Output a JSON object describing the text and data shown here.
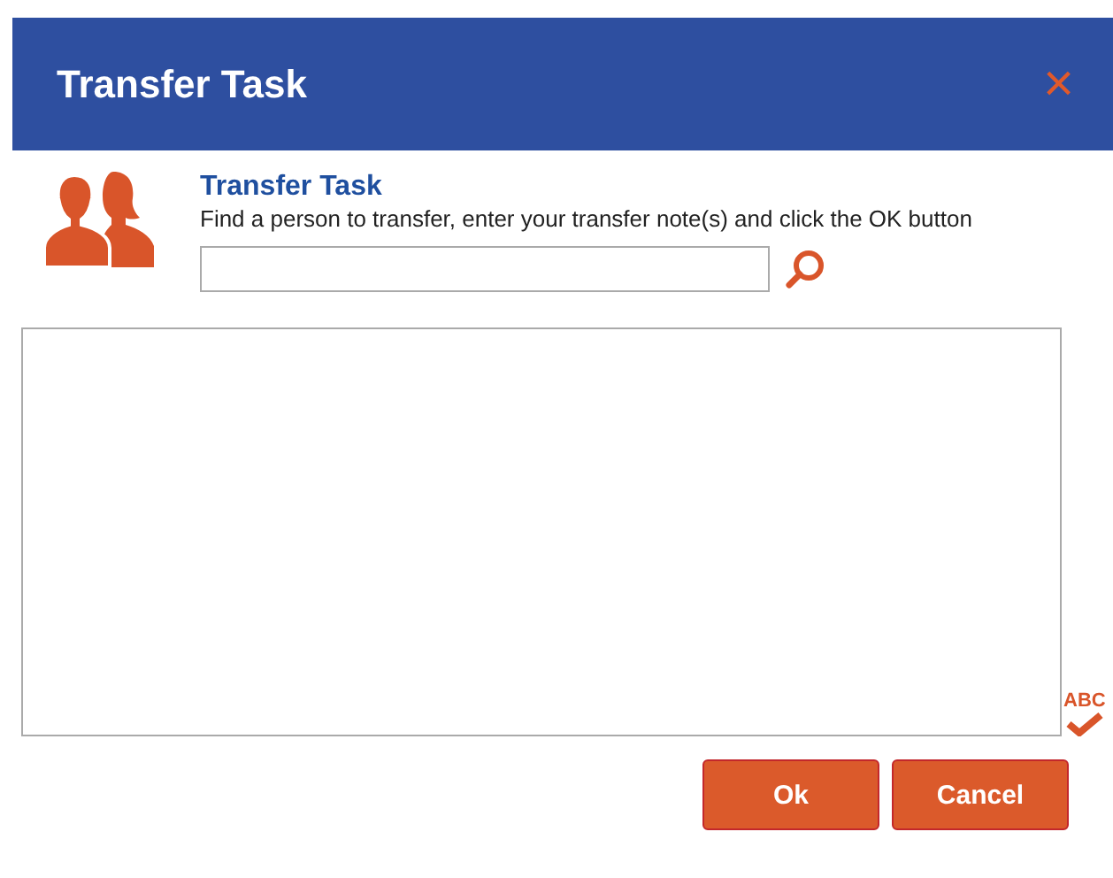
{
  "window": {
    "title": "Transfer Task",
    "close": "×"
  },
  "heading": "Transfer Task",
  "instructions": "Find a person to transfer, enter your transfer note(s) and click the OK button",
  "spellcheck": "ABC",
  "buttons": [
    "Ok",
    "Cancel"
  ]
}
